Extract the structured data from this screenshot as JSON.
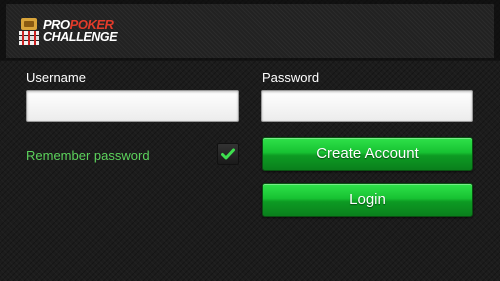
{
  "logo": {
    "line1_a": "PRO",
    "line1_b": "POKER",
    "line2": "CHALLENGE"
  },
  "form": {
    "username_label": "Username",
    "username_value": "",
    "password_label": "Password",
    "password_value": "",
    "remember_label": "Remember password",
    "remember_checked": true,
    "create_account_label": "Create Account",
    "login_label": "Login"
  },
  "colors": {
    "accent_green": "#17c232",
    "remember_text": "#5cd35c",
    "logo_red": "#e23b2a"
  },
  "icons": {
    "logo_emblem": "poker-chips-emblem-icon",
    "checkbox_mark": "checkmark-icon"
  }
}
